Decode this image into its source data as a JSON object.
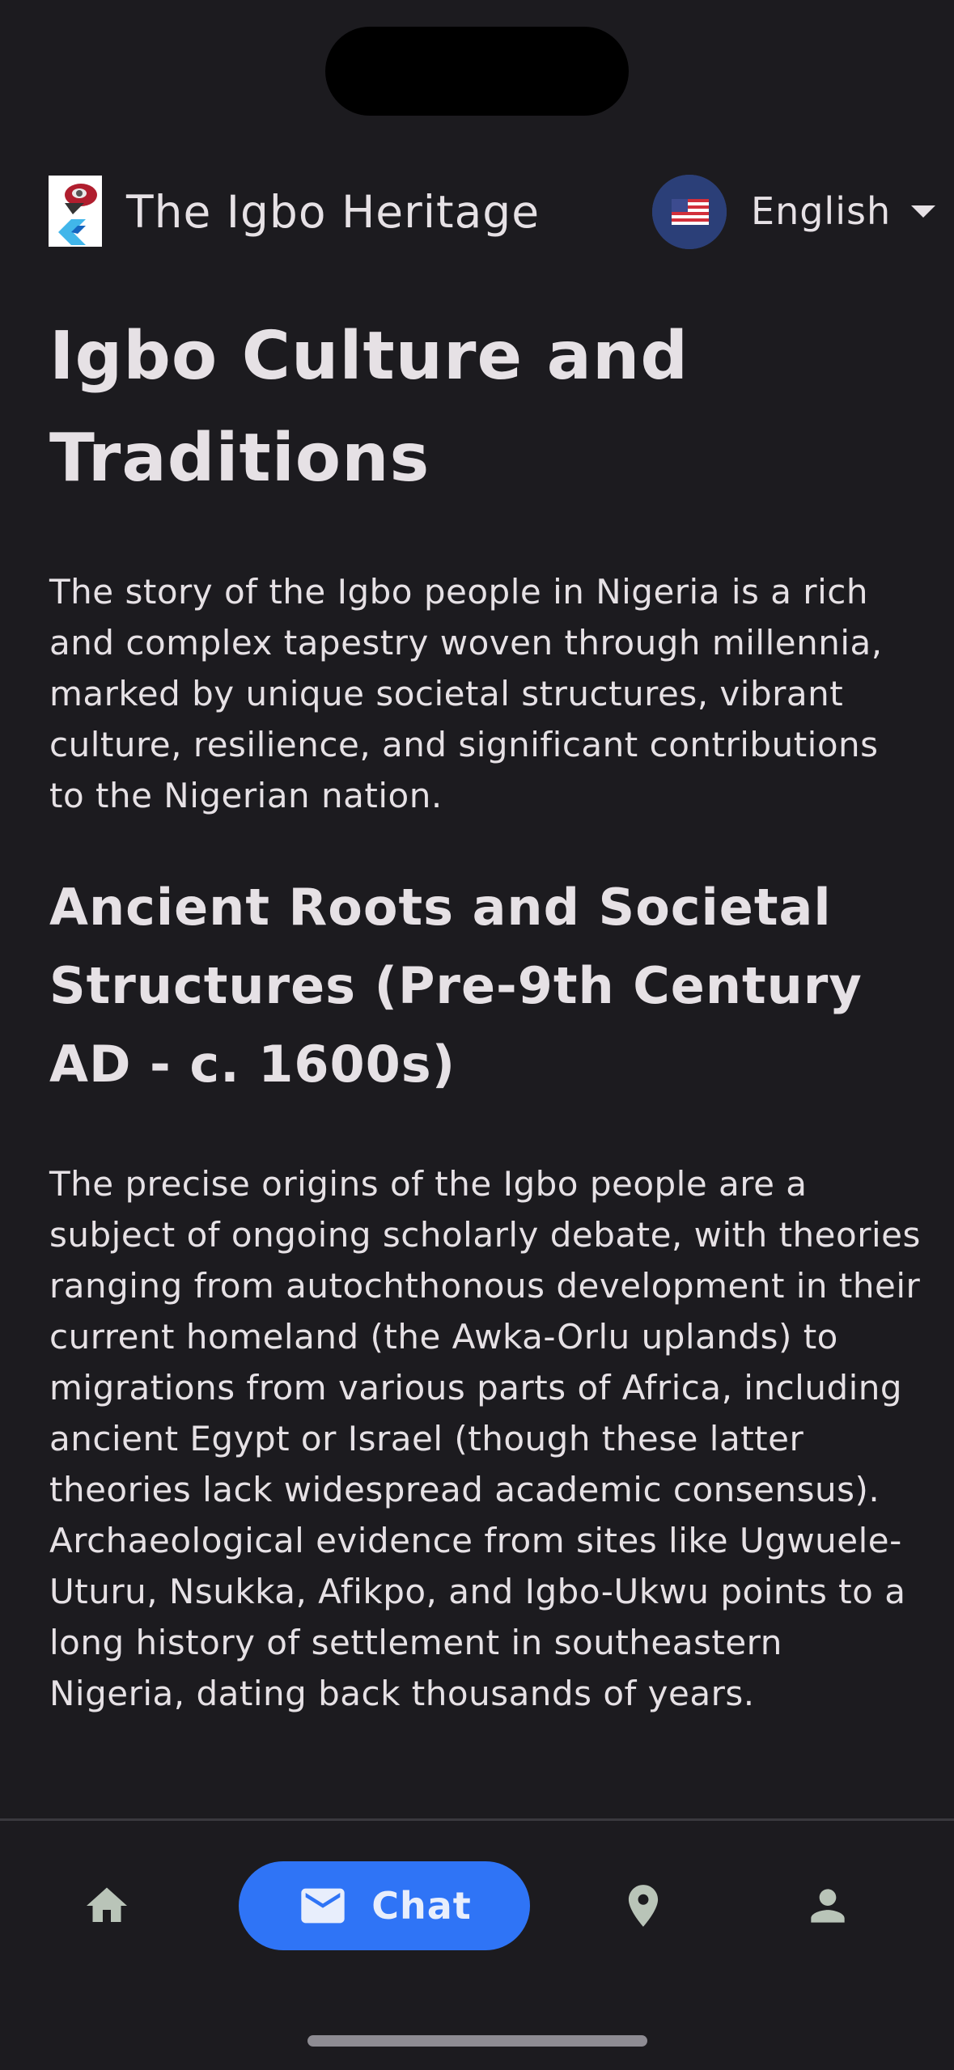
{
  "app_bar": {
    "title": "The Igbo Heritage",
    "language": "English"
  },
  "article": {
    "title": "Igbo Culture and Traditions",
    "intro": "The story of the Igbo people in Nigeria is a rich and complex tapestry woven through millennia, marked by unique societal structures, vibrant culture, resilience, and significant contributions to the Nigerian nation.",
    "section_title": "Ancient Roots and Societal Structures (Pre-9th Century AD - c. 1600s)",
    "section_body": "The precise origins of the Igbo people are a subject of ongoing scholarly debate, with theories ranging from autochthonous development in their current homeland (the Awka-Orlu uplands) to migrations from various parts of Africa, including ancient Egypt or Israel (though these latter theories lack widespread academic consensus). Archaeological evidence from sites like Ugwuele-Uturu, Nsukka, Afikpo, and Igbo-Ukwu points to a long history of settlement in southeastern Nigeria, dating back thousands of years."
  },
  "bottom_nav": {
    "items": [
      {
        "icon": "home-icon",
        "label": ""
      },
      {
        "icon": "mail-icon",
        "label": "Chat",
        "active": true
      },
      {
        "icon": "location-pin-icon",
        "label": ""
      },
      {
        "icon": "person-icon",
        "label": ""
      }
    ]
  },
  "colors": {
    "background": "#1c1b1f",
    "text": "#e6e1e5",
    "accent": "#2f74f6",
    "nav_icon": "#b9c4b8"
  }
}
